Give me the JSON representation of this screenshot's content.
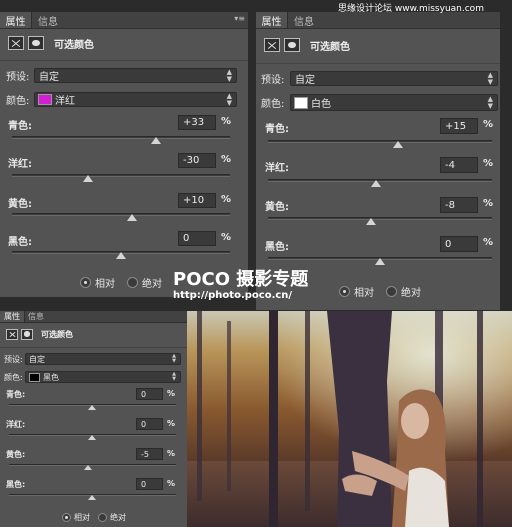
{
  "watermark": "思缘设计论坛 www.missyuan.com",
  "logo": {
    "brand": "POCO 摄影专题",
    "url": "http://photo.poco.cn/"
  },
  "panels": [
    {
      "tabs": [
        "属性",
        "信息"
      ],
      "header_title": "可选颜色",
      "preset_label": "预设:",
      "preset_value": "自定",
      "color_label": "颜色:",
      "color_value": "洋红",
      "color_swatch": "#d41ed6",
      "sliders": [
        {
          "label": "青色:",
          "value": "+33",
          "pct": "%",
          "level": 0.665
        },
        {
          "label": "洋红:",
          "value": "-30",
          "pct": "%",
          "level": 0.35
        },
        {
          "label": "黄色:",
          "value": "+10",
          "pct": "%",
          "level": 0.555
        },
        {
          "label": "黑色:",
          "value": "0",
          "pct": "%",
          "level": 0.5
        }
      ],
      "radio_relative": "相对",
      "radio_absolute": "绝对",
      "selected": "relative"
    },
    {
      "tabs": [
        "属性",
        "信息"
      ],
      "header_title": "可选颜色",
      "preset_label": "预设:",
      "preset_value": "自定",
      "color_label": "颜色:",
      "color_value": "白色",
      "color_swatch": "#ffffff",
      "sliders": [
        {
          "label": "青色:",
          "value": "+15",
          "pct": "%",
          "level": 0.575
        },
        {
          "label": "洋红:",
          "value": "-4",
          "pct": "%",
          "level": 0.48
        },
        {
          "label": "黄色:",
          "value": "-8",
          "pct": "%",
          "level": 0.46
        },
        {
          "label": "黑色:",
          "value": "0",
          "pct": "%",
          "level": 0.5
        }
      ],
      "radio_relative": "相对",
      "radio_absolute": "绝对",
      "selected": "relative"
    },
    {
      "tabs": [
        "属性",
        "信息"
      ],
      "header_title": "可选颜色",
      "preset_label": "预设:",
      "preset_value": "自定",
      "color_label": "颜色:",
      "color_value": "黑色",
      "color_swatch": "#000000",
      "sliders": [
        {
          "label": "青色:",
          "value": "0",
          "pct": "%",
          "level": 0.5
        },
        {
          "label": "洋红:",
          "value": "0",
          "pct": "%",
          "level": 0.5
        },
        {
          "label": "黄色:",
          "value": "-5",
          "pct": "%",
          "level": 0.475
        },
        {
          "label": "黑色:",
          "value": "0",
          "pct": "%",
          "level": 0.5
        }
      ],
      "radio_relative": "相对",
      "radio_absolute": "绝对",
      "selected": "relative"
    }
  ]
}
